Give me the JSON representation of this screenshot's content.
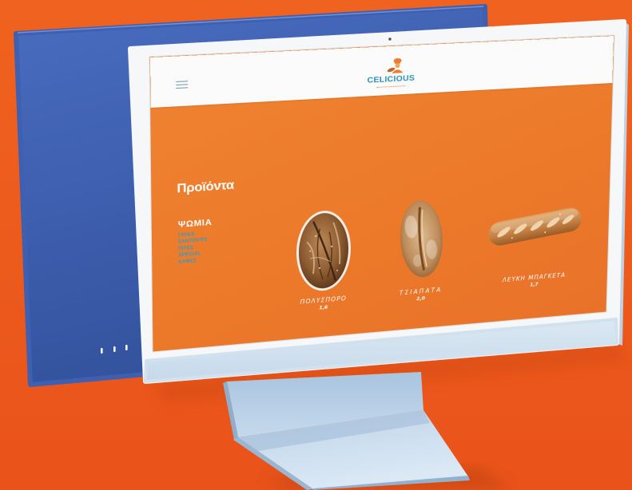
{
  "colors": {
    "background": "#EE5B1E",
    "screen_orange": "#EC7A2A",
    "accent_teal": "#2D9DC6",
    "logo_blue": "#2A8FB8",
    "back_monitor_blue": "#3E5FAF",
    "imac_body": "#F5F7F9",
    "imac_chin": "#D2E1EE",
    "text_white": "#FFFFFF"
  },
  "header": {
    "menu_icon": "hamburger-menu-icon",
    "logo_icon": "baker-logo-icon",
    "logo_text": "CELICIOUS"
  },
  "products_page": {
    "title": "Προϊόντα",
    "active_category": "ΨΩΜΙΑ",
    "categories": [
      "ΓΛΥΚΑ",
      "ΣΑΝΤΟΥΙΤΣ",
      "ΠΙΤΕΣ",
      "SPECIAL",
      "ΚΑΦΕΣ"
    ],
    "products": [
      {
        "name": "ΠΟΛΥΣΠΟΡΟ",
        "price": "1,6",
        "image_icon": "multigrain-loaf-image"
      },
      {
        "name": "ΤΣΙΑΠΑΤΑ",
        "price": "2,0",
        "image_icon": "ciabatta-image"
      },
      {
        "name": "ΛΕΥΚΗ ΜΠΑΓΚΕΤΑ",
        "price": "1,7",
        "image_icon": "baguette-image"
      }
    ]
  }
}
